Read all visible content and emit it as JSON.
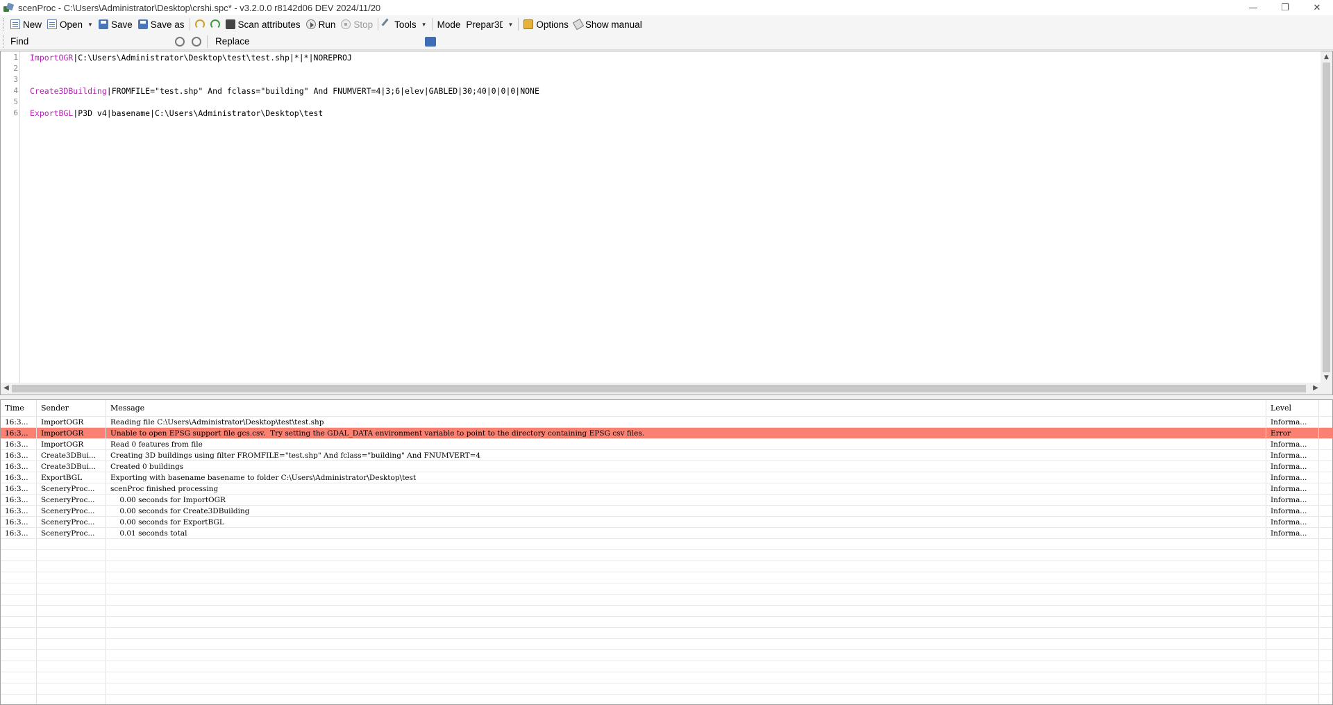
{
  "window": {
    "title": "scenProc - C:\\Users\\Administrator\\Desktop\\crshi.spc* - v3.2.0.0 r8142d06 DEV 2024/11/20",
    "controls": {
      "minimize": "—",
      "restore": "❐",
      "close": "✕"
    }
  },
  "toolbar": {
    "new_label": "New",
    "open_label": "Open",
    "save_label": "Save",
    "saveas_label": "Save as",
    "scan_label": "Scan attributes",
    "run_label": "Run",
    "stop_label": "Stop",
    "tools_label": "Tools",
    "mode_label": "Mode",
    "mode_value": "Prepar3D",
    "options_label": "Options",
    "manual_label": "Show manual"
  },
  "findbar": {
    "find_label": "Find",
    "find_value": "",
    "replace_label": "Replace",
    "replace_value": ""
  },
  "editor": {
    "line_numbers": [
      "1",
      "2",
      "3",
      "4",
      "5",
      "6"
    ],
    "lines": [
      {
        "kw": "ImportOGR",
        "rest": "|C:\\Users\\Administrator\\Desktop\\test\\test.shp|*|*|NOREPROJ"
      },
      {
        "kw": "",
        "rest": ""
      },
      {
        "kw": "",
        "rest": ""
      },
      {
        "kw": "Create3DBuilding",
        "rest": "|FROMFILE=\"test.shp\" And fclass=\"building\" And FNUMVERT=4|3;6|elev|GABLED|30;40|0|0|0|NONE"
      },
      {
        "kw": "",
        "rest": ""
      },
      {
        "kw": "ExportBGL",
        "rest": "|P3D v4|basename|C:\\Users\\Administrator\\Desktop\\test"
      }
    ]
  },
  "log": {
    "headers": {
      "time": "Time",
      "sender": "Sender",
      "message": "Message",
      "level": "Level"
    },
    "rows": [
      {
        "time": "16:3...",
        "sender": "ImportOGR",
        "message": "Reading file C:\\Users\\Administrator\\Desktop\\test\\test.shp",
        "level": "Informa..."
      },
      {
        "time": "16:3...",
        "sender": "ImportOGR",
        "message": "Unable to open EPSG support file gcs.csv.  Try setting the GDAL_DATA environment variable to point to the directory containing EPSG csv files.",
        "level": "Error"
      },
      {
        "time": "16:3...",
        "sender": "ImportOGR",
        "message": "Read 0 features from file",
        "level": "Informa..."
      },
      {
        "time": "16:3...",
        "sender": "Create3DBui...",
        "message": "Creating 3D buildings using filter FROMFILE=\"test.shp\" And fclass=\"building\" And FNUMVERT=4",
        "level": "Informa..."
      },
      {
        "time": "16:3...",
        "sender": "Create3DBui...",
        "message": "Created 0 buildings",
        "level": "Informa..."
      },
      {
        "time": "16:3...",
        "sender": "ExportBGL",
        "message": "Exporting with basename basename to folder C:\\Users\\Administrator\\Desktop\\test",
        "level": "Informa..."
      },
      {
        "time": "16:3...",
        "sender": "SceneryProc...",
        "message": "scenProc finished processing",
        "level": "Informa..."
      },
      {
        "time": "16:3...",
        "sender": "SceneryProc...",
        "message": "    0.00 seconds for ImportOGR",
        "level": "Informa..."
      },
      {
        "time": "16:3...",
        "sender": "SceneryProc...",
        "message": "    0.00 seconds for Create3DBuilding",
        "level": "Informa..."
      },
      {
        "time": "16:3...",
        "sender": "SceneryProc...",
        "message": "    0.00 seconds for ExportBGL",
        "level": "Informa..."
      },
      {
        "time": "16:3...",
        "sender": "SceneryProc...",
        "message": "    0.01 seconds total",
        "level": "Informa..."
      }
    ]
  },
  "colors": {
    "error_row": "#fa8072",
    "keyword": "#b022b0",
    "separator": "#4040d0"
  },
  "icons": [
    "app-icon",
    "new-icon",
    "open-icon",
    "save-icon",
    "saveas-icon",
    "undo-icon",
    "redo-icon",
    "scan-icon",
    "run-icon",
    "stop-icon",
    "tools-icon",
    "options-icon",
    "manual-icon",
    "find-next-icon",
    "find-prev-icon",
    "swap-icon"
  ]
}
